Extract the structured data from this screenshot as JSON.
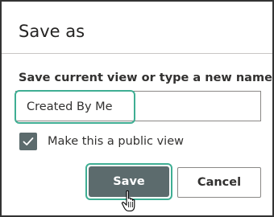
{
  "dialog": {
    "title": "Save as",
    "field_label": "Save current view or type a new name",
    "input_value": "Created By Me",
    "checkbox_label": "Make this a public view",
    "checkbox_checked": true,
    "save_label": "Save",
    "cancel_label": "Cancel"
  },
  "icons": {
    "checkbox": "checkmark-icon",
    "cursor": "hand-pointer-cursor-icon"
  },
  "colors": {
    "primary_button": "#5c6b6d",
    "highlight": "#3fae93",
    "border": "#8a8886",
    "text": "#323130"
  }
}
